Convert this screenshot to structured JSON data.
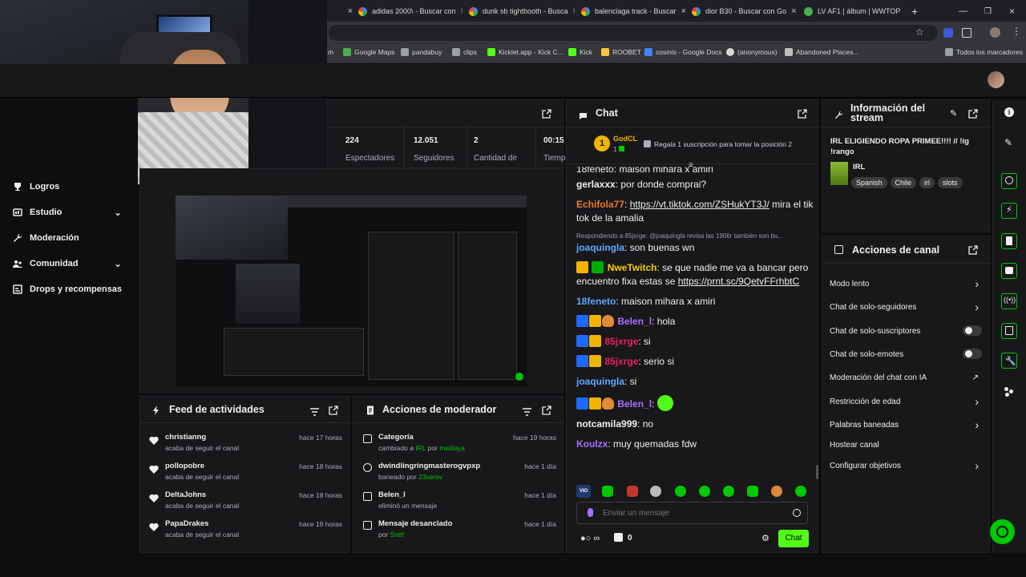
{
  "browser": {
    "tabs": [
      {
        "title": "adidas 2000\\ - Buscar con"
      },
      {
        "title": "dunk sb tightbooth - Busca"
      },
      {
        "title": "balenciaga track - Buscar"
      },
      {
        "title": "dior B30 - Buscar con Go"
      },
      {
        "title": "LV AF1 | álbum | WWTOP"
      }
    ],
    "new_tab": "+",
    "bookmarks": [
      {
        "label": "m"
      },
      {
        "label": "Google Maps"
      },
      {
        "label": "pandabuy"
      },
      {
        "label": "clips"
      },
      {
        "label": "Kicklet.app - Kick C..."
      },
      {
        "label": "Kick"
      },
      {
        "label": "ROOBET"
      },
      {
        "label": "cosinis - Google Docs"
      },
      {
        "label": "(anonymous)"
      },
      {
        "label": "Abandoned Places..."
      }
    ],
    "all_bookmarks": "Todos los marcadores"
  },
  "leftnav": {
    "items": [
      {
        "label": "Logros"
      },
      {
        "label": "Estudio"
      },
      {
        "label": "Moderación"
      },
      {
        "label": "Comunidad"
      },
      {
        "label": "Drops y recompensas"
      }
    ]
  },
  "stats": [
    {
      "value": "224",
      "label": "Espectadores"
    },
    {
      "value": "12.051",
      "label": "Seguidores"
    },
    {
      "value": "2",
      "label": "Cantidad de"
    },
    {
      "value": "00:15",
      "label": "Tiemp"
    }
  ],
  "feed": {
    "title": "Feed de actividades",
    "items": [
      {
        "name": "christianng",
        "sub": "acaba de seguir el canal",
        "time": "hace 17 horas"
      },
      {
        "name": "pollopobre",
        "sub": "acaba de seguir el canal",
        "time": "hace 18 horas"
      },
      {
        "name": "DeltaJohns",
        "sub": "acaba de seguir el canal",
        "time": "hace 18 horas"
      },
      {
        "name": "PapaDrakes",
        "sub": "acaba de seguir el canal",
        "time": "hace 19 horas"
      }
    ]
  },
  "modactions": {
    "title": "Acciones de moderador",
    "items": [
      {
        "name": "Categoría",
        "sub_pre": "cambiado a ",
        "sub_hl1": "IRL",
        "sub_mid": " por ",
        "sub_hl2": "matilaya",
        "time": "hace 19 horas"
      },
      {
        "name": "dwindlingringmasterogvpxp",
        "sub_pre": "baneado por ",
        "sub_hl1": "23versv",
        "sub_mid": "",
        "sub_hl2": "",
        "time": "hace 1 día"
      },
      {
        "name": "Belen_l",
        "sub_pre": "eliminó un mensaje",
        "sub_hl1": "",
        "sub_mid": "",
        "sub_hl2": "",
        "time": "hace 1 día"
      },
      {
        "name": "Mensaje desanclado",
        "sub_pre": "por ",
        "sub_hl1": "Sntt!",
        "sub_mid": "",
        "sub_hl2": "",
        "time": "hace 1 día"
      }
    ]
  },
  "chat": {
    "title": "Chat",
    "top_gifter": {
      "rank": "1",
      "name": "GodCL",
      "count": "1"
    },
    "gift_prompt": "Regala 1 suscripción para tomar la posición 2",
    "partial_top": "18feneto: maison mihara x amiri",
    "messages": [
      {
        "user": "gerlaxxx",
        "color": "#efeff1",
        "text": "por donde comprai?"
      },
      {
        "user": "Echifola77",
        "color": "#e87a2a",
        "link": "https://vt.tiktok.com/ZSHukYT3J/",
        "text": " mira el tik tok de la amalia"
      },
      {
        "reply": "Respondiendo a 85jxrge: @joaquingla revisa las 1906r también son bu...",
        "user": "joaquingla",
        "color": "#5fa8ff",
        "text": "son buenas wn"
      },
      {
        "user": "NweTwitch",
        "color": "#f5d000",
        "text": "se que nadie me va a bancar pero encuentro fixa estas se",
        "link": "https://prnt.sc/9QetvFFrhbtC"
      },
      {
        "user": "18feneto",
        "color": "#5fa8ff",
        "text": "maison mihara x amiri"
      },
      {
        "user": "Belen_l",
        "color": "#a970ff",
        "text": "hola"
      },
      {
        "user": "85jxrge",
        "color": "#e8215a",
        "text": "si"
      },
      {
        "user": "85jxrge",
        "color": "#e8215a",
        "text": "serio si"
      },
      {
        "user": "joaquingla",
        "color": "#5fa8ff",
        "text": "si"
      },
      {
        "user": "Belen_l",
        "color": "#a970ff",
        "text": ""
      },
      {
        "user": "notcamila999",
        "color": "#efeff1",
        "text": "no"
      },
      {
        "user": "Koulzx",
        "color": "#a970ff",
        "text": "muy quemadas fdw"
      }
    ],
    "input_placeholder": "Enviar un mensaje",
    "points": "0",
    "send_label": "Chat"
  },
  "stream_info": {
    "title": "Información del stream",
    "stream_title": "IRL ELIGIENDO ROPA PRIMEE!!!! // !ig !rango",
    "category": "IRL",
    "tags": [
      "Spanish",
      "Chile",
      "irl",
      "slots"
    ]
  },
  "channel_actions": {
    "title": "Acciones de canal",
    "items": [
      {
        "label": "Modo lento",
        "kind": "arrow"
      },
      {
        "label": "Chat de solo-seguidores",
        "kind": "arrow"
      },
      {
        "label": "Chat de solo-suscriptores",
        "kind": "toggle"
      },
      {
        "label": "Chat de solo-emotes",
        "kind": "toggle"
      },
      {
        "label": "Moderación del chat con IA",
        "kind": "external"
      },
      {
        "label": "Restricción de edad",
        "kind": "arrow"
      },
      {
        "label": "Palabras baneadas",
        "kind": "arrow"
      },
      {
        "label": "Hostear canal",
        "kind": "none"
      },
      {
        "label": "Configurar objetivos",
        "kind": "arrow"
      }
    ]
  },
  "colors": {
    "accent": "#00c800",
    "bg": "#0e0e10",
    "panel": "#18181b"
  }
}
